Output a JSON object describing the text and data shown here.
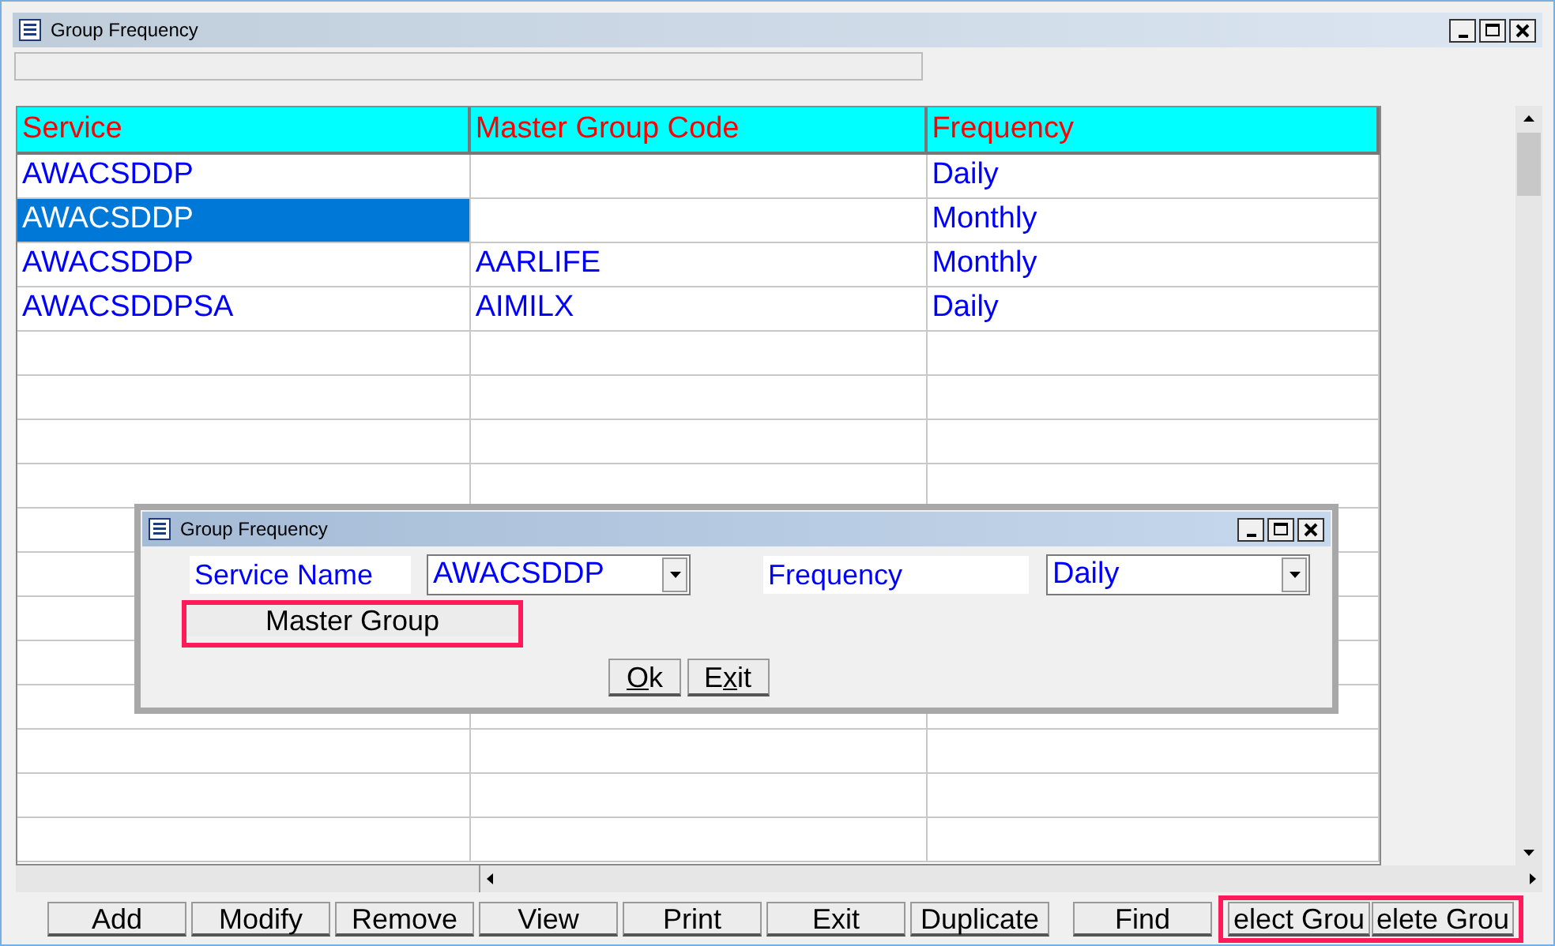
{
  "window": {
    "title": "Group Frequency"
  },
  "table": {
    "columns": [
      "Service",
      "Master Group Code",
      "Frequency"
    ],
    "rows": [
      {
        "cells": [
          "AWACSDDP",
          "",
          "Daily"
        ],
        "selected": false
      },
      {
        "cells": [
          "AWACSDDP",
          "",
          "Monthly"
        ],
        "selected": true
      },
      {
        "cells": [
          "AWACSDDP",
          "AARLIFE",
          "Monthly"
        ],
        "selected": false
      },
      {
        "cells": [
          "AWACSDDPSA",
          "AIMILX",
          "Daily"
        ],
        "selected": false
      }
    ]
  },
  "dialog": {
    "title": "Group Frequency",
    "service_label": "Service Name",
    "service_value": "AWACSDDP",
    "frequency_label": "Frequency",
    "frequency_value": "Daily",
    "master_group_button": "Master Group",
    "buttons": [
      {
        "mnemonic": "O",
        "after": "k"
      },
      {
        "before": "E",
        "mnemonic": "x",
        "after": "it"
      }
    ]
  },
  "buttons": [
    "Add",
    "Modify",
    "Remove",
    "View",
    "Print",
    "Exit",
    "Duplicate",
    "Find"
  ],
  "highlighted_buttons": [
    "elect Grou",
    "elete Grou"
  ]
}
